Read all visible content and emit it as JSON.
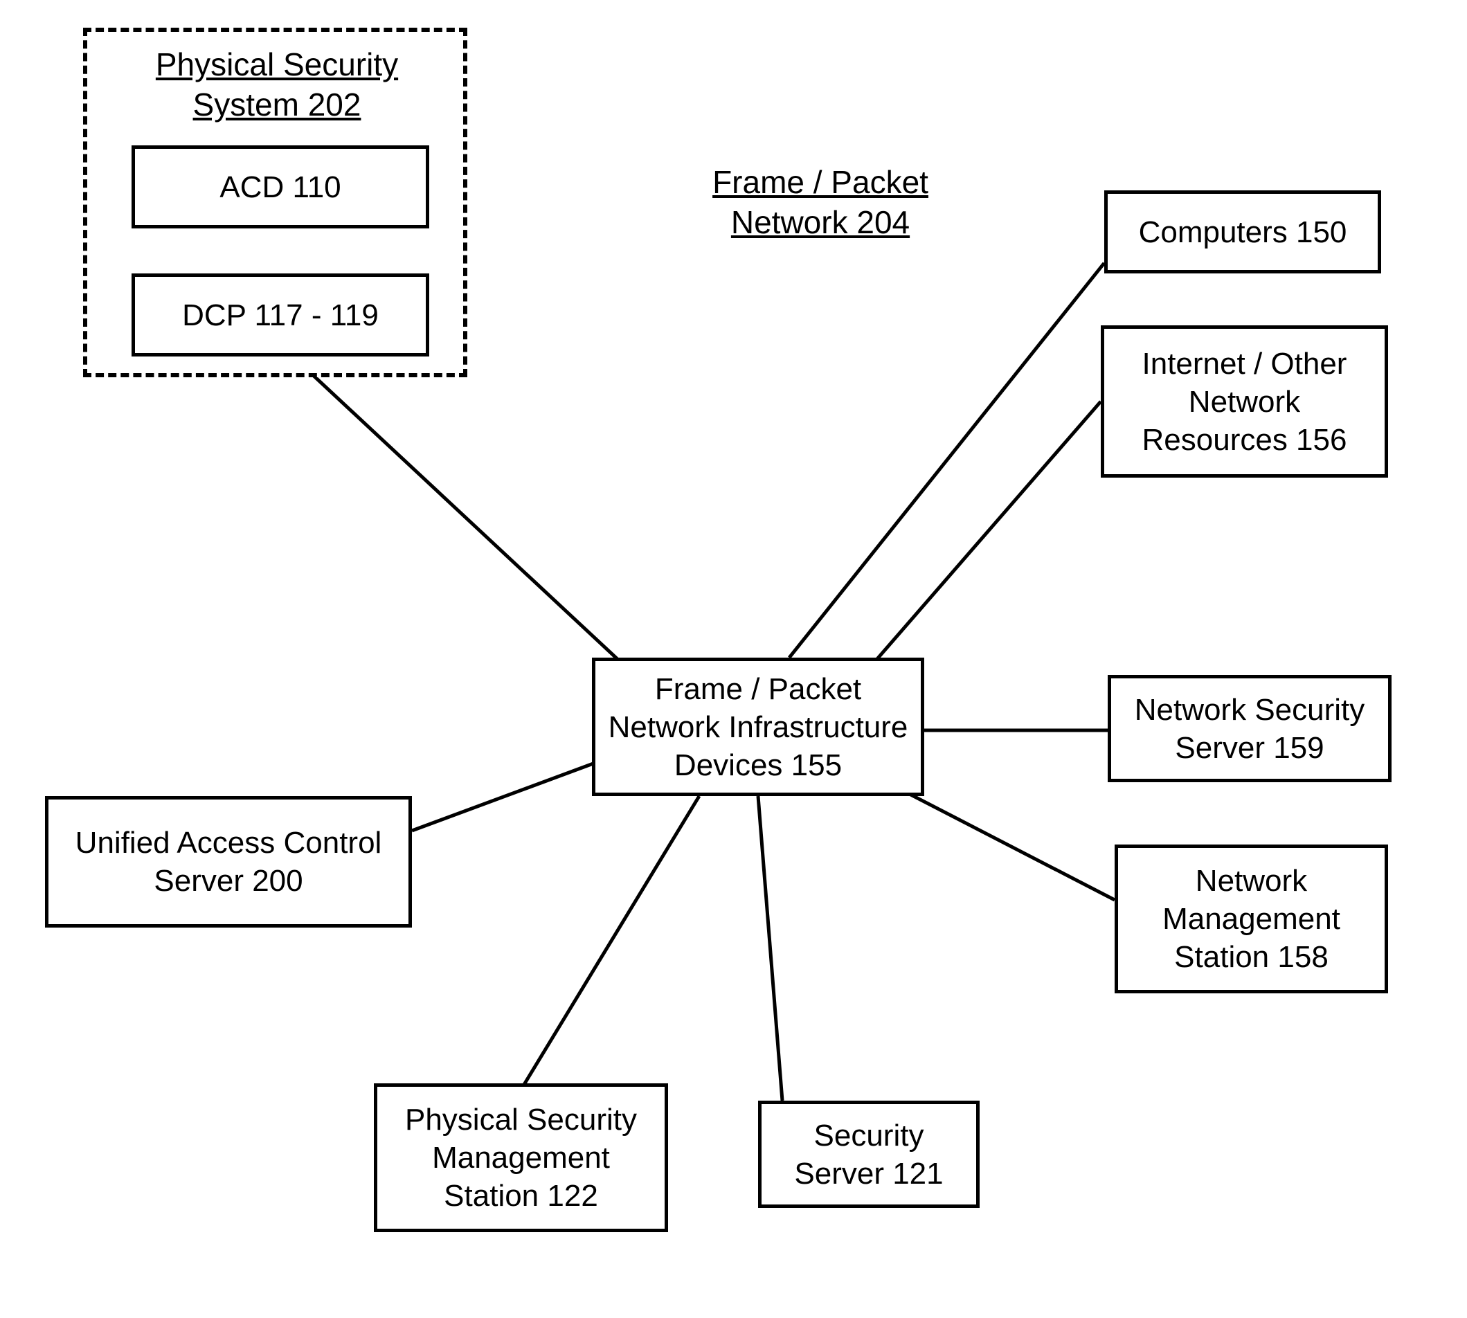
{
  "headings": {
    "physical_security": "Physical Security\nSystem 202",
    "frame_packet_network": "Frame / Packet\nNetwork 204"
  },
  "nodes": {
    "acd": "ACD 110",
    "dcp": "DCP 117 - 119",
    "computers": "Computers 150",
    "internet_resources": "Internet / Other\nNetwork\nResources 156",
    "hub": "Frame / Packet\nNetwork Infrastructure\nDevices 155",
    "network_security_server": "Network Security\nServer 159",
    "unified_access_control": "Unified Access Control\nServer 200",
    "network_management": "Network\nManagement\nStation 158",
    "physical_security_mgmt": "Physical Security\nManagement\nStation 122",
    "security_server": "Security\nServer 121"
  }
}
